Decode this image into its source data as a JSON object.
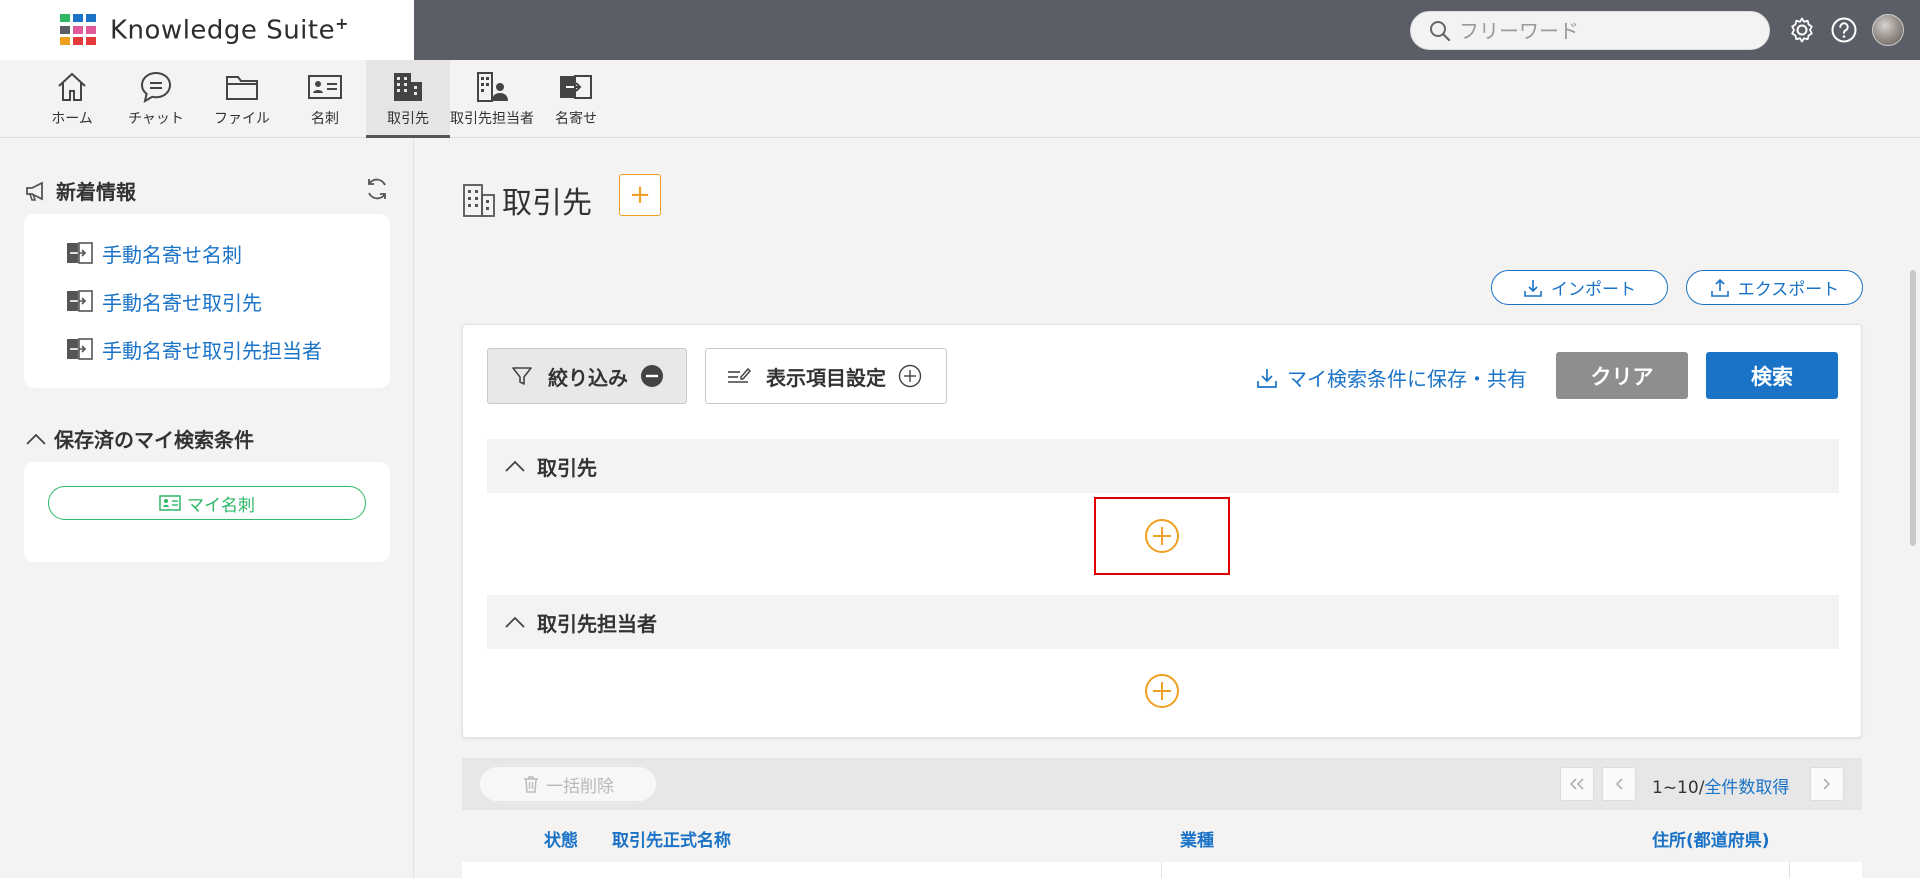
{
  "header": {
    "brand": "Knowledge Suite",
    "brand_suffix": "+",
    "search_placeholder": "フリーワード",
    "logo_colors": [
      "#2db766",
      "#1a73c7",
      "#e05a9a",
      "#f0a020",
      "#e33b3b",
      "#5b5e66"
    ]
  },
  "nav": {
    "items": [
      {
        "label": "ホーム",
        "icon": "home-icon"
      },
      {
        "label": "チャット",
        "icon": "chat-icon"
      },
      {
        "label": "ファイル",
        "icon": "folder-icon"
      },
      {
        "label": "名刺",
        "icon": "business-card-icon"
      },
      {
        "label": "取引先",
        "icon": "building-icon",
        "active": true
      },
      {
        "label": "取引先担当者",
        "icon": "building-person-icon"
      },
      {
        "label": "名寄せ",
        "icon": "merge-icon"
      }
    ]
  },
  "sidebar": {
    "news_title": "新着情報",
    "news_items": [
      "手動名寄せ名刺",
      "手動名寄せ取引先",
      "手動名寄せ取引先担当者"
    ],
    "saved_title": "保存済のマイ検索条件",
    "saved_items": [
      "マイ名刺"
    ]
  },
  "main": {
    "title": "取引先",
    "add_label": "+",
    "import_label": "インポート",
    "export_label": "エクスポート",
    "filter_label": "絞り込み",
    "display_settings_label": "表示項目設定",
    "save_search_label": "マイ検索条件に保存・共有",
    "clear_label": "クリア",
    "search_label": "検索",
    "sections": [
      "取引先",
      "取引先担当者"
    ]
  },
  "list": {
    "bulk_delete_label": "一括削除",
    "pager_range": "1~10/",
    "pager_total_link": "全件数取得",
    "columns": [
      "状態",
      "取引先正式名称",
      "業種",
      "住所(都道府県)"
    ]
  },
  "colors": {
    "accent_blue": "#1a73c7",
    "accent_orange": "#f0a020",
    "accent_green": "#2db766",
    "header_dark": "#5b5e66",
    "highlight_red": "#e00000"
  }
}
